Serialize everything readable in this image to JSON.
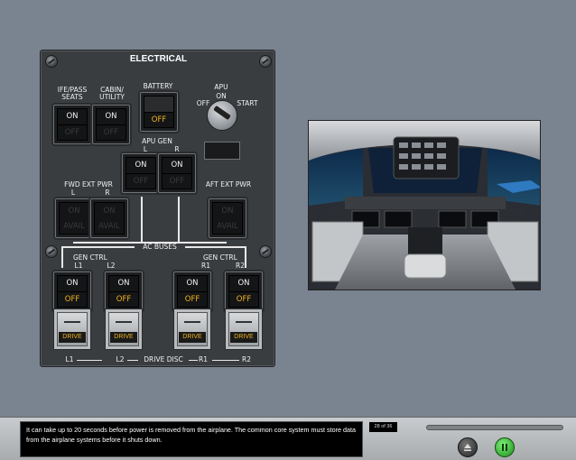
{
  "panel": {
    "title": "ELECTRICAL",
    "ife_pass_seats": "IFE/PASS\nSEATS",
    "cabin_utility": "CABIN/\nUTILITY",
    "battery": "BATTERY",
    "apu": "APU",
    "apu_on": "ON",
    "apu_off": "OFF",
    "apu_start": "START",
    "apu_gen": "APU GEN",
    "fwd_ext_pwr": "FWD EXT PWR",
    "aft_ext_pwr": "AFT EXT PWR",
    "ac_buses": "AC BUSES",
    "gen_ctrl_left": "GEN CTRL",
    "gen_ctrl_right": "GEN CTRL",
    "drive_disc": "DRIVE DISC",
    "l": "L",
    "r": "R",
    "l1": "L1",
    "l2": "L2",
    "r1": "R1",
    "r2": "R2",
    "on": "ON",
    "off": "OFF",
    "avail": "AVAIL",
    "drive": "DRIVE"
  },
  "footer": {
    "caption": "It can take up to 20 seconds before power is removed from the airplane. The common core system must store data from the airplane systems before it shuts down.",
    "pager": "28 of 36"
  },
  "icons": {
    "eject": "eject-icon",
    "pause": "pause-icon"
  }
}
